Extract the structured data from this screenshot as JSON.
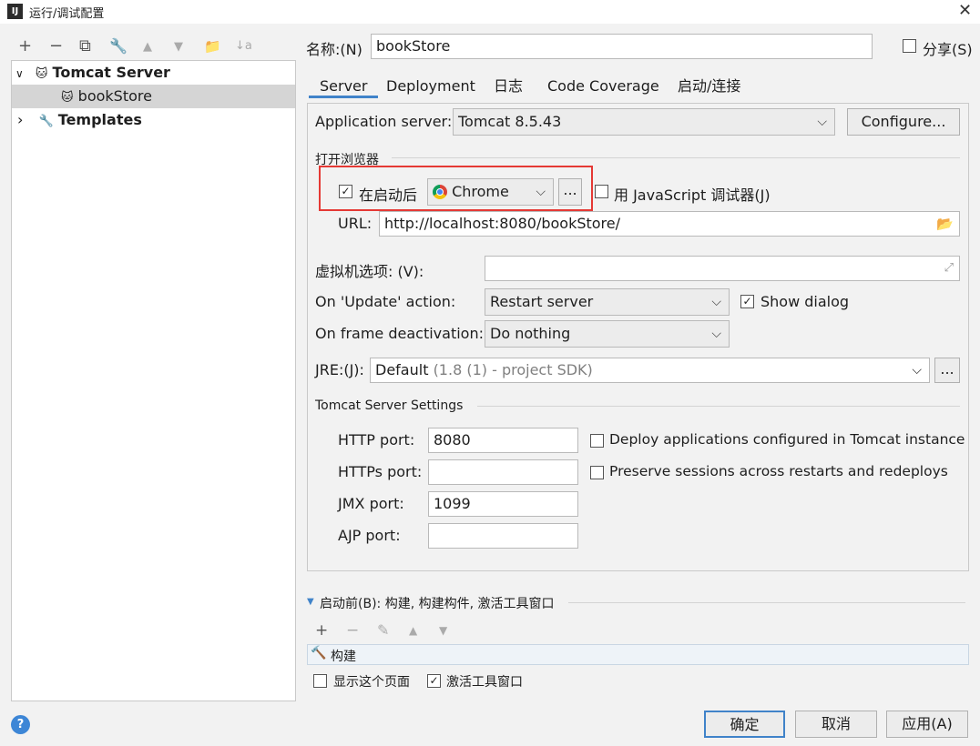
{
  "window": {
    "title": "运行/调试配置",
    "app_icon": "IJ",
    "close_glyph": "✕"
  },
  "sidebar_toolbar": {
    "icons": [
      "+",
      "−",
      "⧉",
      "🔧",
      "▲",
      "▼",
      "📁",
      "↓a"
    ]
  },
  "tree": {
    "items": [
      {
        "label": "Tomcat Server",
        "expander": "∨",
        "icon": "🐱"
      },
      {
        "label": "bookStore",
        "icon": "🐱"
      },
      {
        "label": "Templates",
        "expander": "›",
        "icon": "🔧"
      }
    ]
  },
  "name_field": {
    "label": "名称:(N)",
    "value": "bookStore"
  },
  "share": {
    "label": "分享(S)",
    "checked": false
  },
  "tabs": [
    "Server",
    "Deployment",
    "日志",
    "Code Coverage",
    "启动/连接"
  ],
  "server": {
    "app_server_label": "Application server:",
    "app_server_value": "Tomcat 8.5.43",
    "configure_label": "Configure...",
    "browser_section": "打开浏览器",
    "after_launch_label": "在启动后",
    "after_launch_checked": true,
    "browser_value": "Chrome",
    "browser_more": "...",
    "js_debugger_label": "用 JavaScript 调试器(J)",
    "js_debugger_checked": false,
    "url_label": "URL:",
    "url_value": "http://localhost:8080/bookStore/",
    "vm_options_label": "虚拟机选项: (V):",
    "vm_options_value": "",
    "update_action_label": "On 'Update' action:",
    "update_action_value": "Restart server",
    "show_dialog_label": "Show dialog",
    "show_dialog_checked": true,
    "frame_deactivation_label": "On frame deactivation:",
    "frame_deactivation_value": "Do nothing",
    "jre_label": "JRE:(J):",
    "jre_value": "Default",
    "jre_hint": "(1.8 (1) - project SDK)",
    "jre_more": "...",
    "tomcat_settings_title": "Tomcat Server Settings",
    "http_port_label": "HTTP port:",
    "http_port_value": "8080",
    "https_port_label": "HTTPs port:",
    "https_port_value": "",
    "jmx_port_label": "JMX port:",
    "jmx_port_value": "1099",
    "ajp_port_label": "AJP port:",
    "ajp_port_value": "",
    "deploy_apps_label": "Deploy applications configured in Tomcat instance",
    "deploy_apps_checked": false,
    "preserve_sessions_label": "Preserve sessions across restarts and redeploys",
    "preserve_sessions_checked": false
  },
  "before_launch": {
    "title": "启动前(B): 构建, 构建构件, 激活工具窗口",
    "toolbar_icons": [
      "+",
      "−",
      "✎",
      "▲",
      "▼"
    ],
    "tasks": [
      "构建"
    ],
    "show_page_label": "显示这个页面",
    "show_page_checked": false,
    "activate_window_label": "激活工具窗口",
    "activate_window_checked": true
  },
  "footer": {
    "help": "?",
    "ok": "确定",
    "cancel": "取消",
    "apply": "应用(A)"
  },
  "colors": {
    "accent": "#4083c9",
    "highlight_box": "#e53935",
    "selected_row": "#d5d5d5"
  }
}
